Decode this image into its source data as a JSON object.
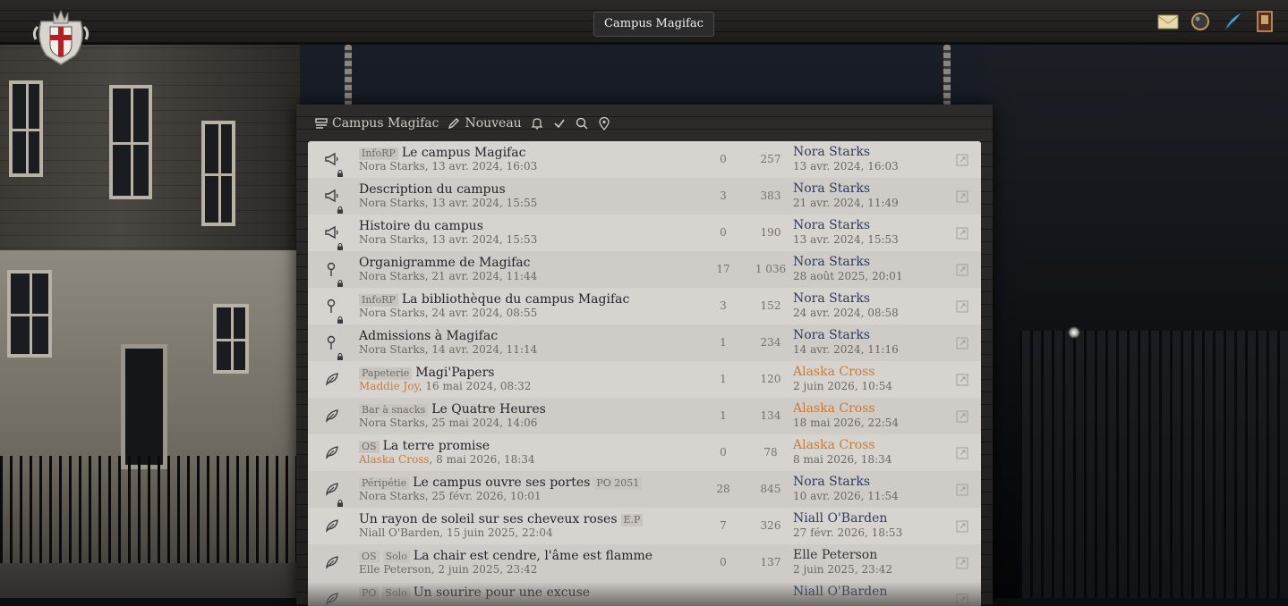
{
  "header": {
    "site_title": "Campus Magifac"
  },
  "top_icons": [
    "envelope-icon",
    "crystal-ball-icon",
    "quill-icon",
    "book-icon"
  ],
  "nav": {
    "forum": "Campus Magifac",
    "new": "Nouveau"
  },
  "threads": [
    {
      "icon": "megaphone",
      "locked": true,
      "prefix": "InfoRP",
      "title": "Le campus Magifac",
      "suffix": "",
      "author": "Nora Starks",
      "author_color": "default",
      "date": ", 13 avr. 2024, 16:03",
      "replies": "0",
      "views": "257",
      "last_user": "Nora Starks",
      "last_color": "blue",
      "last_date": "13 avr. 2024, 16:03"
    },
    {
      "icon": "megaphone",
      "locked": true,
      "prefix": "",
      "title": "Description du campus",
      "suffix": "",
      "author": "Nora Starks",
      "author_color": "default",
      "date": ", 13 avr. 2024, 15:55",
      "replies": "3",
      "views": "383",
      "last_user": "Nora Starks",
      "last_color": "blue",
      "last_date": "21 avr. 2024, 11:49"
    },
    {
      "icon": "megaphone",
      "locked": true,
      "prefix": "",
      "title": "Histoire du campus",
      "suffix": "",
      "author": "Nora Starks",
      "author_color": "default",
      "date": ", 13 avr. 2024, 15:53",
      "replies": "0",
      "views": "190",
      "last_user": "Nora Starks",
      "last_color": "blue",
      "last_date": "13 avr. 2024, 15:53"
    },
    {
      "icon": "pin",
      "locked": true,
      "prefix": "",
      "title": "Organigramme de Magifac",
      "suffix": "",
      "author": "Nora Starks",
      "author_color": "default",
      "date": ", 21 avr. 2024, 11:44",
      "replies": "17",
      "views": "1 036",
      "last_user": "Nora Starks",
      "last_color": "blue",
      "last_date": "28 août 2025, 20:01"
    },
    {
      "icon": "pin",
      "locked": true,
      "prefix": "InfoRP",
      "title": "La bibliothèque du campus Magifac",
      "suffix": "",
      "author": "Nora Starks",
      "author_color": "default",
      "date": ", 24 avr. 2024, 08:55",
      "replies": "3",
      "views": "152",
      "last_user": "Nora Starks",
      "last_color": "blue",
      "last_date": "24 avr. 2024, 08:58"
    },
    {
      "icon": "pin",
      "locked": true,
      "prefix": "",
      "title": "Admissions à Magifac",
      "suffix": "",
      "author": "Nora Starks",
      "author_color": "default",
      "date": ", 14 avr. 2024, 11:14",
      "replies": "1",
      "views": "234",
      "last_user": "Nora Starks",
      "last_color": "blue",
      "last_date": "14 avr. 2024, 11:16"
    },
    {
      "icon": "feather",
      "locked": false,
      "prefix": "Papeterie",
      "title": "Magi'Papers",
      "suffix": "",
      "author": "Maddie Joy",
      "author_color": "orange",
      "date": ", 16 mai 2024, 08:32",
      "replies": "1",
      "views": "120",
      "last_user": "Alaska Cross",
      "last_color": "orange",
      "last_date": "2 juin 2026, 10:54"
    },
    {
      "icon": "feather",
      "locked": false,
      "prefix": "Bar à snacks",
      "title": "Le Quatre Heures",
      "suffix": "",
      "author": "Nora Starks",
      "author_color": "default",
      "date": ", 25 mai 2024, 14:06",
      "replies": "1",
      "views": "134",
      "last_user": "Alaska Cross",
      "last_color": "orange",
      "last_date": "18 mai 2026, 22:54"
    },
    {
      "icon": "feather",
      "locked": false,
      "prefix": "OS",
      "title": "La terre promise",
      "suffix": "",
      "author": "Alaska Cross",
      "author_color": "orange",
      "date": ", 8 mai 2026, 18:34",
      "replies": "0",
      "views": "78",
      "last_user": "Alaska Cross",
      "last_color": "orange",
      "last_date": "8 mai 2026, 18:34"
    },
    {
      "icon": "feather",
      "locked": true,
      "prefix": "Péripétie",
      "title": "Le campus ouvre ses portes",
      "suffix": "PO 2051",
      "author": "Nora Starks",
      "author_color": "default",
      "date": ", 25 févr. 2026, 10:01",
      "replies": "28",
      "views": "845",
      "last_user": "Nora Starks",
      "last_color": "blue",
      "last_date": "10 avr. 2026, 11:54"
    },
    {
      "icon": "feather",
      "locked": false,
      "prefix": "",
      "title": "Un rayon de soleil sur ses cheveux roses",
      "suffix": "E.P",
      "author": "Niall O'Barden",
      "author_color": "default",
      "date": ", 15 juin 2025, 22:04",
      "replies": "7",
      "views": "326",
      "last_user": "Niall O'Barden",
      "last_color": "blue",
      "last_date": "27 févr. 2026, 18:53"
    },
    {
      "icon": "feather",
      "locked": false,
      "prefix": "OS",
      "prefix2": "Solo",
      "title": "La chair est cendre, l'âme est flamme",
      "suffix": "",
      "author": "Elle Peterson",
      "author_color": "default",
      "date": ", 2 juin 2025, 23:42",
      "replies": "0",
      "views": "137",
      "last_user": "Elle Peterson",
      "last_color": "dark",
      "last_date": "2 juin 2025, 23:42"
    },
    {
      "icon": "feather",
      "locked": false,
      "prefix": "PO",
      "prefix2": "Solo",
      "title": "Un sourire pour une excuse",
      "suffix": "",
      "author": "",
      "author_color": "default",
      "date": "",
      "replies": "",
      "views": "",
      "last_user": "Niall O'Barden",
      "last_color": "blue",
      "last_date": ""
    }
  ]
}
